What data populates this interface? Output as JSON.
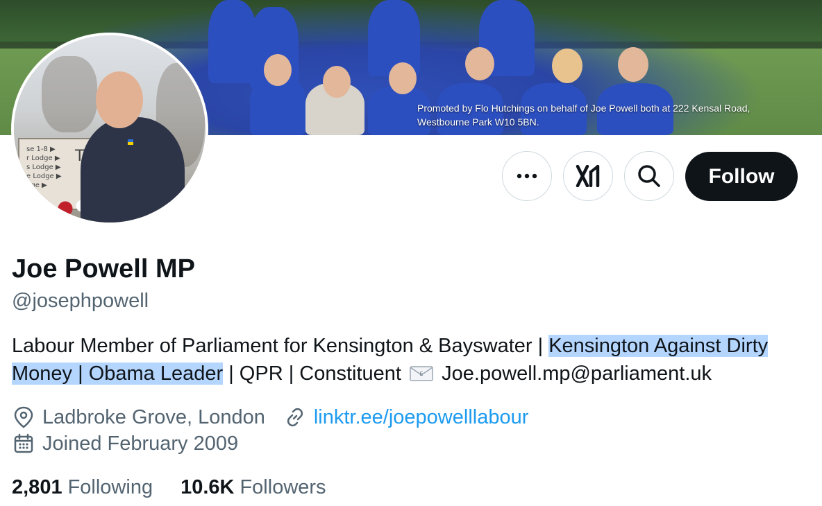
{
  "banner": {
    "caption_line1": "Promoted by Flo Hutchings on behalf of Joe Powell both at 222 Kensal Road,",
    "caption_line2": "Westbourne Park W10 5BN."
  },
  "avatar": {
    "sign_lines": "se 1-8 ▶\nr Lodge ▶\ns Lodge ▶\ne Lodge ▶\ndge ▶\nge)",
    "sign_name": "Thor"
  },
  "actions": {
    "more_icon": "more-icon",
    "grok_icon": "grok-icon",
    "search_icon": "search-icon",
    "follow_label": "Follow"
  },
  "profile": {
    "display_name": "Joe Powell MP",
    "handle": "@josephpowell",
    "bio": {
      "part1": "Labour Member of Parliament for Kensington & Bayswater | ",
      "highlighted": "Kensington Against Dirty Money | Obama Leader",
      "part2": " | QPR | Constituent ",
      "email": "Joe.powell.mp@parliament.uk"
    },
    "location": "Ladbroke Grove, London",
    "link": "linktr.ee/joepowelllabour",
    "joined": "Joined February 2009"
  },
  "stats": {
    "following_count": "2,801",
    "following_label": "Following",
    "followers_count": "10.6K",
    "followers_label": "Followers"
  },
  "colors": {
    "accent": "#1d9bf0",
    "text_primary": "#0f1419",
    "text_secondary": "#536471",
    "highlight": "#b4d5fe",
    "border": "#cfd9de"
  }
}
